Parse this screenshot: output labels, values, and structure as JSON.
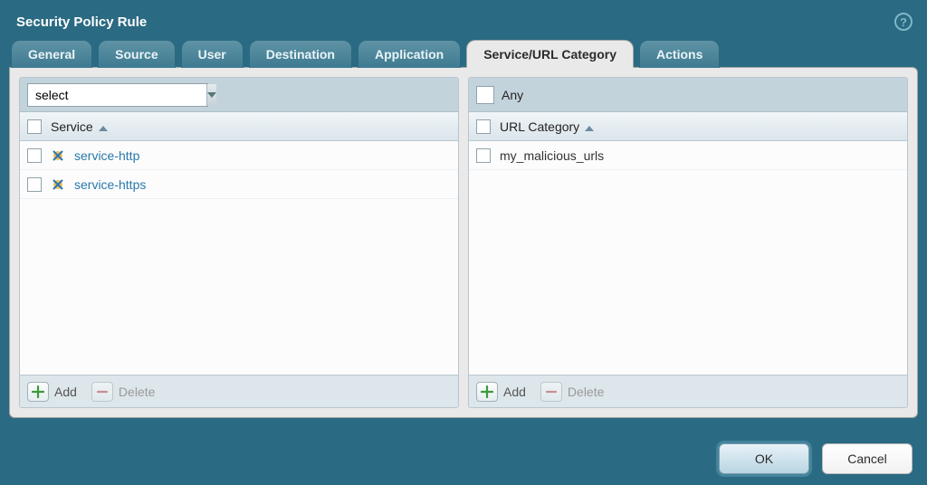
{
  "title": "Security Policy Rule",
  "tabs": [
    {
      "label": "General"
    },
    {
      "label": "Source"
    },
    {
      "label": "User"
    },
    {
      "label": "Destination"
    },
    {
      "label": "Application"
    },
    {
      "label": "Service/URL Category",
      "active": true
    },
    {
      "label": "Actions"
    }
  ],
  "leftPanel": {
    "selectValue": "select",
    "header": "Service",
    "rows": [
      {
        "label": "service-http"
      },
      {
        "label": "service-https"
      }
    ],
    "addLabel": "Add",
    "deleteLabel": "Delete"
  },
  "rightPanel": {
    "anyLabel": "Any",
    "header": "URL Category",
    "rows": [
      {
        "label": "my_malicious_urls"
      }
    ],
    "addLabel": "Add",
    "deleteLabel": "Delete"
  },
  "buttons": {
    "ok": "OK",
    "cancel": "Cancel"
  }
}
